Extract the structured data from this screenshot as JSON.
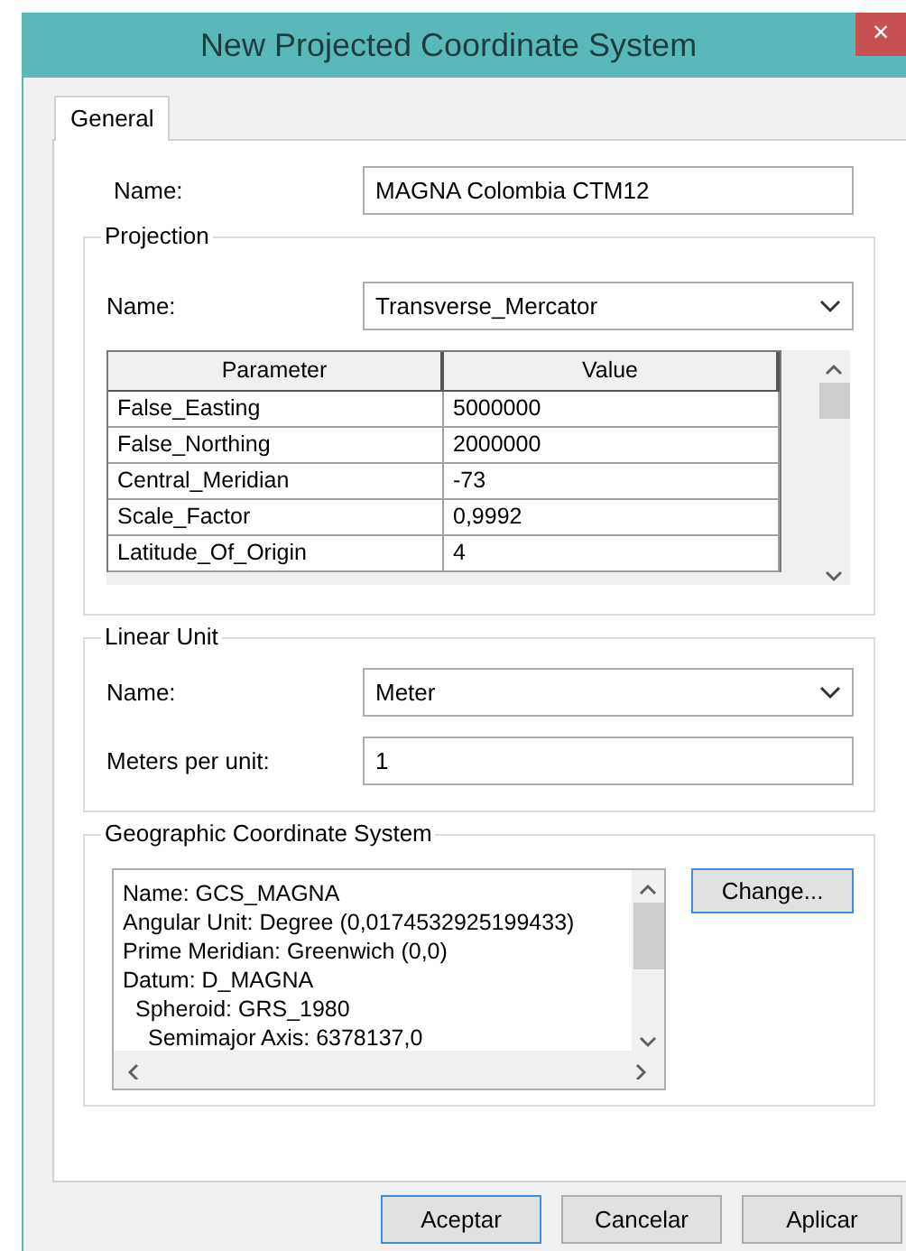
{
  "window": {
    "title": "New Projected Coordinate System",
    "close": "×"
  },
  "tabs": [
    {
      "label": "General",
      "selected": true
    }
  ],
  "name": {
    "label": "Name:",
    "value": "MAGNA Colombia CTM12"
  },
  "projection": {
    "title": "Projection",
    "name_label": "Name:",
    "name_value": "Transverse_Mercator",
    "table": {
      "columns": [
        "Parameter",
        "Value"
      ],
      "rows": [
        [
          "False_Easting",
          "5000000"
        ],
        [
          "False_Northing",
          "2000000"
        ],
        [
          "Central_Meridian",
          "-73"
        ],
        [
          "Scale_Factor",
          "0,9992"
        ],
        [
          "Latitude_Of_Origin",
          "4"
        ]
      ]
    }
  },
  "linear_unit": {
    "title": "Linear Unit",
    "name_label": "Name:",
    "name_value": "Meter",
    "meters_label": "Meters per unit:",
    "meters_value": "1"
  },
  "gcs": {
    "title": "Geographic Coordinate System",
    "change_button": "Change...",
    "lines": [
      {
        "text": "Name: GCS_MAGNA"
      },
      {
        "text": "Angular Unit: Degree (0,0174532925199433)"
      },
      {
        "text": "Prime Meridian: Greenwich (0,0)"
      },
      {
        "text": "Datum: D_MAGNA",
        "children": [
          {
            "text": "Spheroid: GRS_1980",
            "children": [
              {
                "text": "Semimajor Axis: 6378137,0"
              }
            ]
          }
        ]
      }
    ]
  },
  "buttons": [
    {
      "label": "Aceptar",
      "focused": true
    },
    {
      "label": "Cancelar",
      "focused": false
    },
    {
      "label": "Aplicar",
      "focused": false
    }
  ]
}
